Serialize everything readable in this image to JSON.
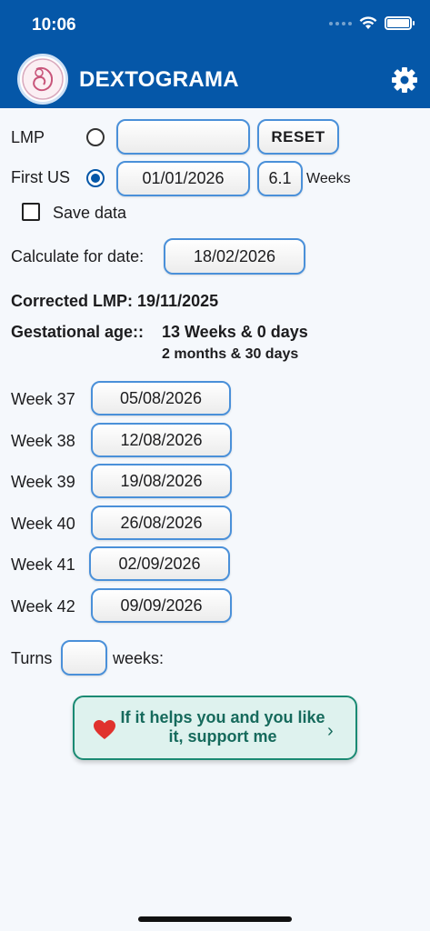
{
  "status_bar": {
    "time": "10:06"
  },
  "header": {
    "title": "DEXTOGRAMA"
  },
  "form": {
    "lmp_label": "LMP",
    "lmp_value": "",
    "reset_label": "RESET",
    "first_us_label": "First US",
    "first_us_date": "01/01/2026",
    "first_us_weeks_value": "6.1",
    "weeks_unit": "Weeks",
    "save_data_label": "Save data",
    "save_data_checked": false,
    "selected_radio": "First US",
    "calc_label": "Calculate for date:",
    "calc_date": "18/02/2026"
  },
  "results": {
    "corrected_lmp": "Corrected LMP: 19/11/2025",
    "gestational_age_label": "Gestational age::",
    "gestational_age_weeks": "13 Weeks & 0 days",
    "gestational_age_months": "2 months & 30 days"
  },
  "weeks": [
    {
      "label": "Week 37",
      "date": "05/08/2026"
    },
    {
      "label": "Week 38",
      "date": "12/08/2026"
    },
    {
      "label": "Week 39",
      "date": "19/08/2026"
    },
    {
      "label": "Week 40",
      "date": "26/08/2026"
    },
    {
      "label": "Week 41",
      "date": "02/09/2026"
    },
    {
      "label": "Week 42",
      "date": "09/09/2026"
    }
  ],
  "turns": {
    "label": "Turns",
    "value": "",
    "suffix": "weeks:"
  },
  "support": {
    "text": "If it helps you and you like it, support me"
  },
  "colors": {
    "header": "#0557a8",
    "input_border": "#4a90d9",
    "support_border": "#1a8a73",
    "heart": "#e0322d"
  },
  "icons": {
    "settings": "gear-icon",
    "support": "heart-icon",
    "support_arrow": "chevron-right-icon"
  }
}
